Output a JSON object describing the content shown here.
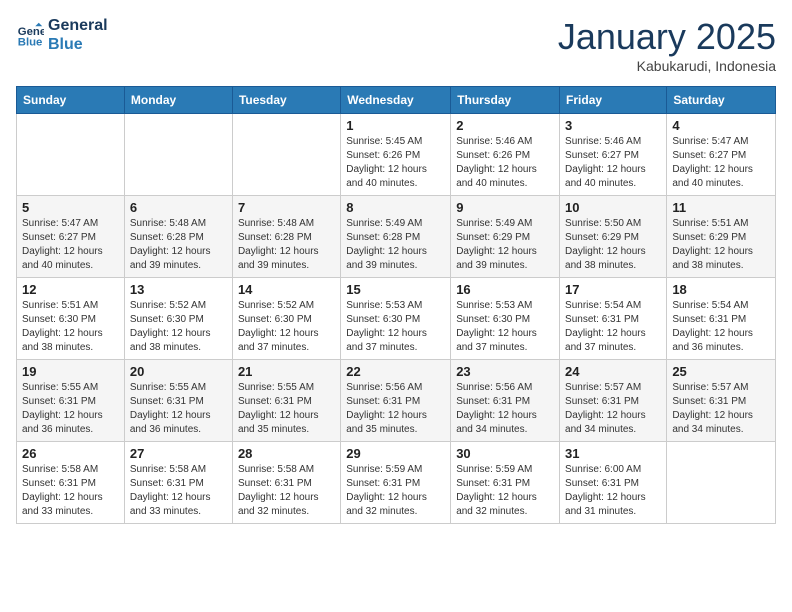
{
  "header": {
    "logo_line1": "General",
    "logo_line2": "Blue",
    "month": "January 2025",
    "location": "Kabukarudi, Indonesia"
  },
  "weekdays": [
    "Sunday",
    "Monday",
    "Tuesday",
    "Wednesday",
    "Thursday",
    "Friday",
    "Saturday"
  ],
  "weeks": [
    [
      {
        "day": "",
        "info": ""
      },
      {
        "day": "",
        "info": ""
      },
      {
        "day": "",
        "info": ""
      },
      {
        "day": "1",
        "info": "Sunrise: 5:45 AM\nSunset: 6:26 PM\nDaylight: 12 hours\nand 40 minutes."
      },
      {
        "day": "2",
        "info": "Sunrise: 5:46 AM\nSunset: 6:26 PM\nDaylight: 12 hours\nand 40 minutes."
      },
      {
        "day": "3",
        "info": "Sunrise: 5:46 AM\nSunset: 6:27 PM\nDaylight: 12 hours\nand 40 minutes."
      },
      {
        "day": "4",
        "info": "Sunrise: 5:47 AM\nSunset: 6:27 PM\nDaylight: 12 hours\nand 40 minutes."
      }
    ],
    [
      {
        "day": "5",
        "info": "Sunrise: 5:47 AM\nSunset: 6:27 PM\nDaylight: 12 hours\nand 40 minutes."
      },
      {
        "day": "6",
        "info": "Sunrise: 5:48 AM\nSunset: 6:28 PM\nDaylight: 12 hours\nand 39 minutes."
      },
      {
        "day": "7",
        "info": "Sunrise: 5:48 AM\nSunset: 6:28 PM\nDaylight: 12 hours\nand 39 minutes."
      },
      {
        "day": "8",
        "info": "Sunrise: 5:49 AM\nSunset: 6:28 PM\nDaylight: 12 hours\nand 39 minutes."
      },
      {
        "day": "9",
        "info": "Sunrise: 5:49 AM\nSunset: 6:29 PM\nDaylight: 12 hours\nand 39 minutes."
      },
      {
        "day": "10",
        "info": "Sunrise: 5:50 AM\nSunset: 6:29 PM\nDaylight: 12 hours\nand 38 minutes."
      },
      {
        "day": "11",
        "info": "Sunrise: 5:51 AM\nSunset: 6:29 PM\nDaylight: 12 hours\nand 38 minutes."
      }
    ],
    [
      {
        "day": "12",
        "info": "Sunrise: 5:51 AM\nSunset: 6:30 PM\nDaylight: 12 hours\nand 38 minutes."
      },
      {
        "day": "13",
        "info": "Sunrise: 5:52 AM\nSunset: 6:30 PM\nDaylight: 12 hours\nand 38 minutes."
      },
      {
        "day": "14",
        "info": "Sunrise: 5:52 AM\nSunset: 6:30 PM\nDaylight: 12 hours\nand 37 minutes."
      },
      {
        "day": "15",
        "info": "Sunrise: 5:53 AM\nSunset: 6:30 PM\nDaylight: 12 hours\nand 37 minutes."
      },
      {
        "day": "16",
        "info": "Sunrise: 5:53 AM\nSunset: 6:30 PM\nDaylight: 12 hours\nand 37 minutes."
      },
      {
        "day": "17",
        "info": "Sunrise: 5:54 AM\nSunset: 6:31 PM\nDaylight: 12 hours\nand 37 minutes."
      },
      {
        "day": "18",
        "info": "Sunrise: 5:54 AM\nSunset: 6:31 PM\nDaylight: 12 hours\nand 36 minutes."
      }
    ],
    [
      {
        "day": "19",
        "info": "Sunrise: 5:55 AM\nSunset: 6:31 PM\nDaylight: 12 hours\nand 36 minutes."
      },
      {
        "day": "20",
        "info": "Sunrise: 5:55 AM\nSunset: 6:31 PM\nDaylight: 12 hours\nand 36 minutes."
      },
      {
        "day": "21",
        "info": "Sunrise: 5:55 AM\nSunset: 6:31 PM\nDaylight: 12 hours\nand 35 minutes."
      },
      {
        "day": "22",
        "info": "Sunrise: 5:56 AM\nSunset: 6:31 PM\nDaylight: 12 hours\nand 35 minutes."
      },
      {
        "day": "23",
        "info": "Sunrise: 5:56 AM\nSunset: 6:31 PM\nDaylight: 12 hours\nand 34 minutes."
      },
      {
        "day": "24",
        "info": "Sunrise: 5:57 AM\nSunset: 6:31 PM\nDaylight: 12 hours\nand 34 minutes."
      },
      {
        "day": "25",
        "info": "Sunrise: 5:57 AM\nSunset: 6:31 PM\nDaylight: 12 hours\nand 34 minutes."
      }
    ],
    [
      {
        "day": "26",
        "info": "Sunrise: 5:58 AM\nSunset: 6:31 PM\nDaylight: 12 hours\nand 33 minutes."
      },
      {
        "day": "27",
        "info": "Sunrise: 5:58 AM\nSunset: 6:31 PM\nDaylight: 12 hours\nand 33 minutes."
      },
      {
        "day": "28",
        "info": "Sunrise: 5:58 AM\nSunset: 6:31 PM\nDaylight: 12 hours\nand 32 minutes."
      },
      {
        "day": "29",
        "info": "Sunrise: 5:59 AM\nSunset: 6:31 PM\nDaylight: 12 hours\nand 32 minutes."
      },
      {
        "day": "30",
        "info": "Sunrise: 5:59 AM\nSunset: 6:31 PM\nDaylight: 12 hours\nand 32 minutes."
      },
      {
        "day": "31",
        "info": "Sunrise: 6:00 AM\nSunset: 6:31 PM\nDaylight: 12 hours\nand 31 minutes."
      },
      {
        "day": "",
        "info": ""
      }
    ]
  ]
}
